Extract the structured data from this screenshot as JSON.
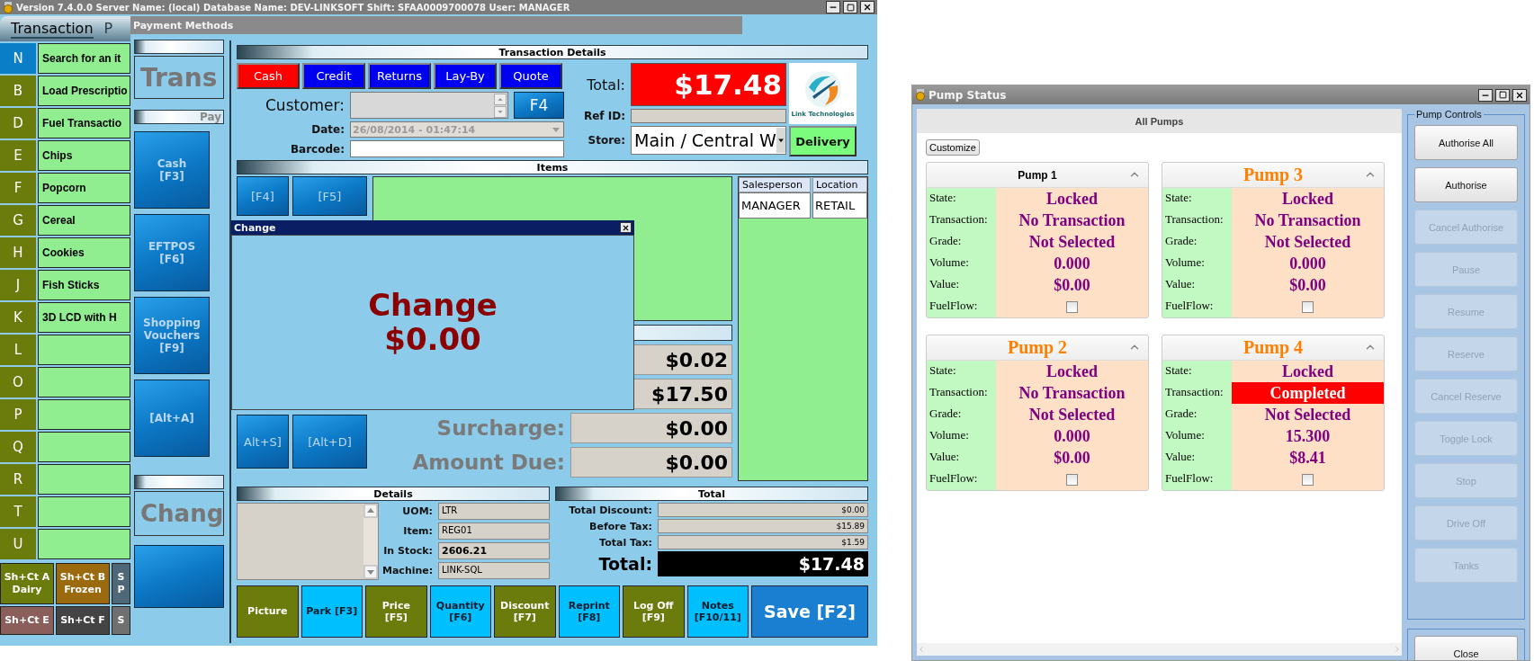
{
  "main_window": {
    "title": "Version 7.4.0.0 Server Name: (local) Database Name: DEV-LINKSOFT Shift: SFAA0009700078 User: MANAGER",
    "tabs": [
      {
        "label": "Transaction",
        "selected": true
      },
      {
        "label": "P",
        "selected": false
      }
    ],
    "hotkeys": [
      {
        "key": "N",
        "label": "Search for an it",
        "color": "#0a7fc8"
      },
      {
        "key": "B",
        "label": "Load Prescriptio",
        "color": "#6b7b0c"
      },
      {
        "key": "D",
        "label": "Fuel Transactio",
        "color": "#6b7b0c"
      },
      {
        "key": "E",
        "label": "Chips",
        "color": "#6b7b0c"
      },
      {
        "key": "F",
        "label": "Popcorn",
        "color": "#6b7b0c"
      },
      {
        "key": "G",
        "label": "Cereal",
        "color": "#6b7b0c"
      },
      {
        "key": "H",
        "label": "Cookies",
        "color": "#6b7b0c"
      },
      {
        "key": "J",
        "label": "Fish Sticks",
        "color": "#6b7b0c"
      },
      {
        "key": "K",
        "label": "3D LCD with H",
        "color": "#6b7b0c"
      },
      {
        "key": "L",
        "color": "#6b7b0c"
      },
      {
        "key": "O",
        "color": "#6b7b0c"
      },
      {
        "key": "P",
        "color": "#6b7b0c"
      },
      {
        "key": "Q",
        "color": "#6b7b0c"
      },
      {
        "key": "R",
        "color": "#6b7b0c"
      },
      {
        "key": "T",
        "color": "#6b7b0c"
      },
      {
        "key": "U",
        "color": "#6b7b0c"
      }
    ],
    "shortcuts": [
      {
        "label": "Sh+Ct A\nDairy",
        "color": "#6b7b0c"
      },
      {
        "label": "Sh+Ct B\nFrozen",
        "color": "#9c6a0e"
      },
      {
        "label": "S\nP",
        "color": "#4e6878"
      },
      {
        "label": "Sh+Ct E",
        "color": "#8a5e5a"
      },
      {
        "label": "Sh+Ct F",
        "color": "#444444"
      },
      {
        "label": "S",
        "color": "#707070"
      }
    ]
  },
  "payment_window": {
    "title": "Payment Methods",
    "heading": "Trans",
    "section": "Pay",
    "methods": [
      "Cash\n[F3]",
      "EFTPOS\n[F6]",
      "Shopping\nVouchers\n[F9]",
      "[Alt+A]"
    ],
    "change_heading": "Chang"
  },
  "transaction_window": {
    "header": "Transaction Details",
    "modes": [
      {
        "label": "Cash",
        "selected": true
      },
      {
        "label": "Credit",
        "selected": false
      },
      {
        "label": "Returns",
        "selected": false
      },
      {
        "label": "Lay-By",
        "selected": false
      },
      {
        "label": "Quote",
        "selected": false
      }
    ],
    "customer": {
      "label": "Customer:",
      "button": "F4"
    },
    "date": {
      "label": "Date:",
      "value": "26/08/2014 - 01:47:14",
      "disabled": true
    },
    "barcode": {
      "label": "Barcode:"
    },
    "total": {
      "label": "Total:",
      "value": "$17.48"
    },
    "ref_id": {
      "label": "Ref ID:"
    },
    "store": {
      "label": "Store:",
      "value": "Main / Central W"
    },
    "logo_text": "Link Technologies",
    "delivery_button": "Delivery",
    "items_header": "Items",
    "quick_buttons": [
      "[F4]",
      "[F5]",
      "Alt+S]",
      "[Alt+D]"
    ],
    "amounts": [
      {
        "value": "$0.02"
      },
      {
        "value": "$17.50"
      },
      {
        "label": "Surcharge:",
        "value": "$0.00"
      },
      {
        "label": "Amount Due:",
        "value": "$0.00"
      }
    ],
    "items_table": {
      "columns": [
        "Salesperson",
        "Location"
      ],
      "rows": [
        [
          "MANAGER",
          "RETAIL"
        ]
      ]
    },
    "details": {
      "header": "Details",
      "fields": [
        {
          "label": "UOM:",
          "value": "LTR",
          "emphasis": false
        },
        {
          "label": "Item:",
          "value": "REG01",
          "emphasis": false
        },
        {
          "label": "In Stock:",
          "value": "2606.21",
          "emphasis": true
        },
        {
          "label": "Machine:",
          "value": "LINK-SQL",
          "emphasis": false
        }
      ]
    },
    "totals": {
      "header": "Total",
      "rows": [
        {
          "label": "Total Discount:",
          "value": "$0.00"
        },
        {
          "label": "Before Tax:",
          "value": "$15.89"
        },
        {
          "label": "Total Tax:",
          "value": "$1.59"
        }
      ],
      "grand_label": "Total:",
      "grand_value": "$17.48"
    },
    "actions": [
      {
        "label": "Picture",
        "color": "#6b7b0c"
      },
      {
        "label": "Park [F3]",
        "color": "#00bfff"
      },
      {
        "label": "Price\n[F5]",
        "color": "#6b7b0c"
      },
      {
        "label": "Quantity\n[F6]",
        "color": "#00bfff"
      },
      {
        "label": "Discount\n[F7]",
        "color": "#6b7b0c"
      },
      {
        "label": "Reprint\n[F8]",
        "color": "#00bfff"
      },
      {
        "label": "Log Off\n[F9]",
        "color": "#6b7b0c"
      },
      {
        "label": "Notes\n[F10/11]",
        "color": "#00bfff"
      },
      {
        "label": "Save [F2]",
        "color": "#1a7fd0"
      }
    ]
  },
  "change_dialog": {
    "title": "Change",
    "heading": "Change",
    "amount": "$0.00"
  },
  "pump_window": {
    "title": "Pump Status",
    "panel_title": "All Pumps",
    "customize_button": "Customize",
    "pumps": [
      {
        "name": "Pump 1",
        "selected": true,
        "rows": [
          {
            "kind": "text",
            "label": "State:",
            "value": "Locked",
            "alert": false
          },
          {
            "kind": "text",
            "label": "Transaction:",
            "value": "No Transaction",
            "alert": false
          },
          {
            "kind": "text",
            "label": "Grade:",
            "value": "Not Selected",
            "alert": false
          },
          {
            "kind": "text",
            "label": "Volume:",
            "value": "0.000",
            "alert": false
          },
          {
            "kind": "text",
            "label": "Value:",
            "value": "$0.00",
            "alert": false
          },
          {
            "kind": "checkbox",
            "label": "FuelFlow:",
            "checked": false
          }
        ]
      },
      {
        "name": "Pump 3",
        "selected": false,
        "rows": [
          {
            "kind": "text",
            "label": "State:",
            "value": "Locked",
            "alert": false
          },
          {
            "kind": "text",
            "label": "Transaction:",
            "value": "No Transaction",
            "alert": false
          },
          {
            "kind": "text",
            "label": "Grade:",
            "value": "Not Selected",
            "alert": false
          },
          {
            "kind": "text",
            "label": "Volume:",
            "value": "0.000",
            "alert": false
          },
          {
            "kind": "text",
            "label": "Value:",
            "value": "$0.00",
            "alert": false
          },
          {
            "kind": "checkbox",
            "label": "FuelFlow:",
            "checked": false
          }
        ]
      },
      {
        "name": "Pump 2",
        "selected": false,
        "rows": [
          {
            "kind": "text",
            "label": "State:",
            "value": "Locked",
            "alert": false
          },
          {
            "kind": "text",
            "label": "Transaction:",
            "value": "No Transaction",
            "alert": false
          },
          {
            "kind": "text",
            "label": "Grade:",
            "value": "Not Selected",
            "alert": false
          },
          {
            "kind": "text",
            "label": "Volume:",
            "value": "0.000",
            "alert": false
          },
          {
            "kind": "text",
            "label": "Value:",
            "value": "$0.00",
            "alert": false
          },
          {
            "kind": "checkbox",
            "label": "FuelFlow:",
            "checked": false
          }
        ]
      },
      {
        "name": "Pump 4",
        "selected": false,
        "rows": [
          {
            "kind": "text",
            "label": "State:",
            "value": "Locked",
            "alert": false
          },
          {
            "kind": "text",
            "label": "Transaction:",
            "value": "Completed",
            "alert": true
          },
          {
            "kind": "text",
            "label": "Grade:",
            "value": "Not Selected",
            "alert": false
          },
          {
            "kind": "text",
            "label": "Volume:",
            "value": "15.300",
            "alert": false
          },
          {
            "kind": "text",
            "label": "Value:",
            "value": "$8.41",
            "alert": false
          },
          {
            "kind": "checkbox",
            "label": "FuelFlow:",
            "checked": false
          }
        ]
      }
    ],
    "controls_title": "Pump Controls",
    "controls": [
      {
        "label": "Authorise All",
        "disabled": false
      },
      {
        "label": "Authorise",
        "disabled": false
      },
      {
        "label": "Cancel Authorise",
        "disabled": true
      },
      {
        "label": "Pause",
        "disabled": true
      },
      {
        "label": "Resume",
        "disabled": true
      },
      {
        "label": "Reserve",
        "disabled": true
      },
      {
        "label": "Cancel Reserve",
        "disabled": true
      },
      {
        "label": "Toggle Lock",
        "disabled": true
      },
      {
        "label": "Stop",
        "disabled": true
      },
      {
        "label": "Drive Off",
        "disabled": true
      },
      {
        "label": "Tanks",
        "disabled": true
      }
    ],
    "close_button": "Close"
  }
}
